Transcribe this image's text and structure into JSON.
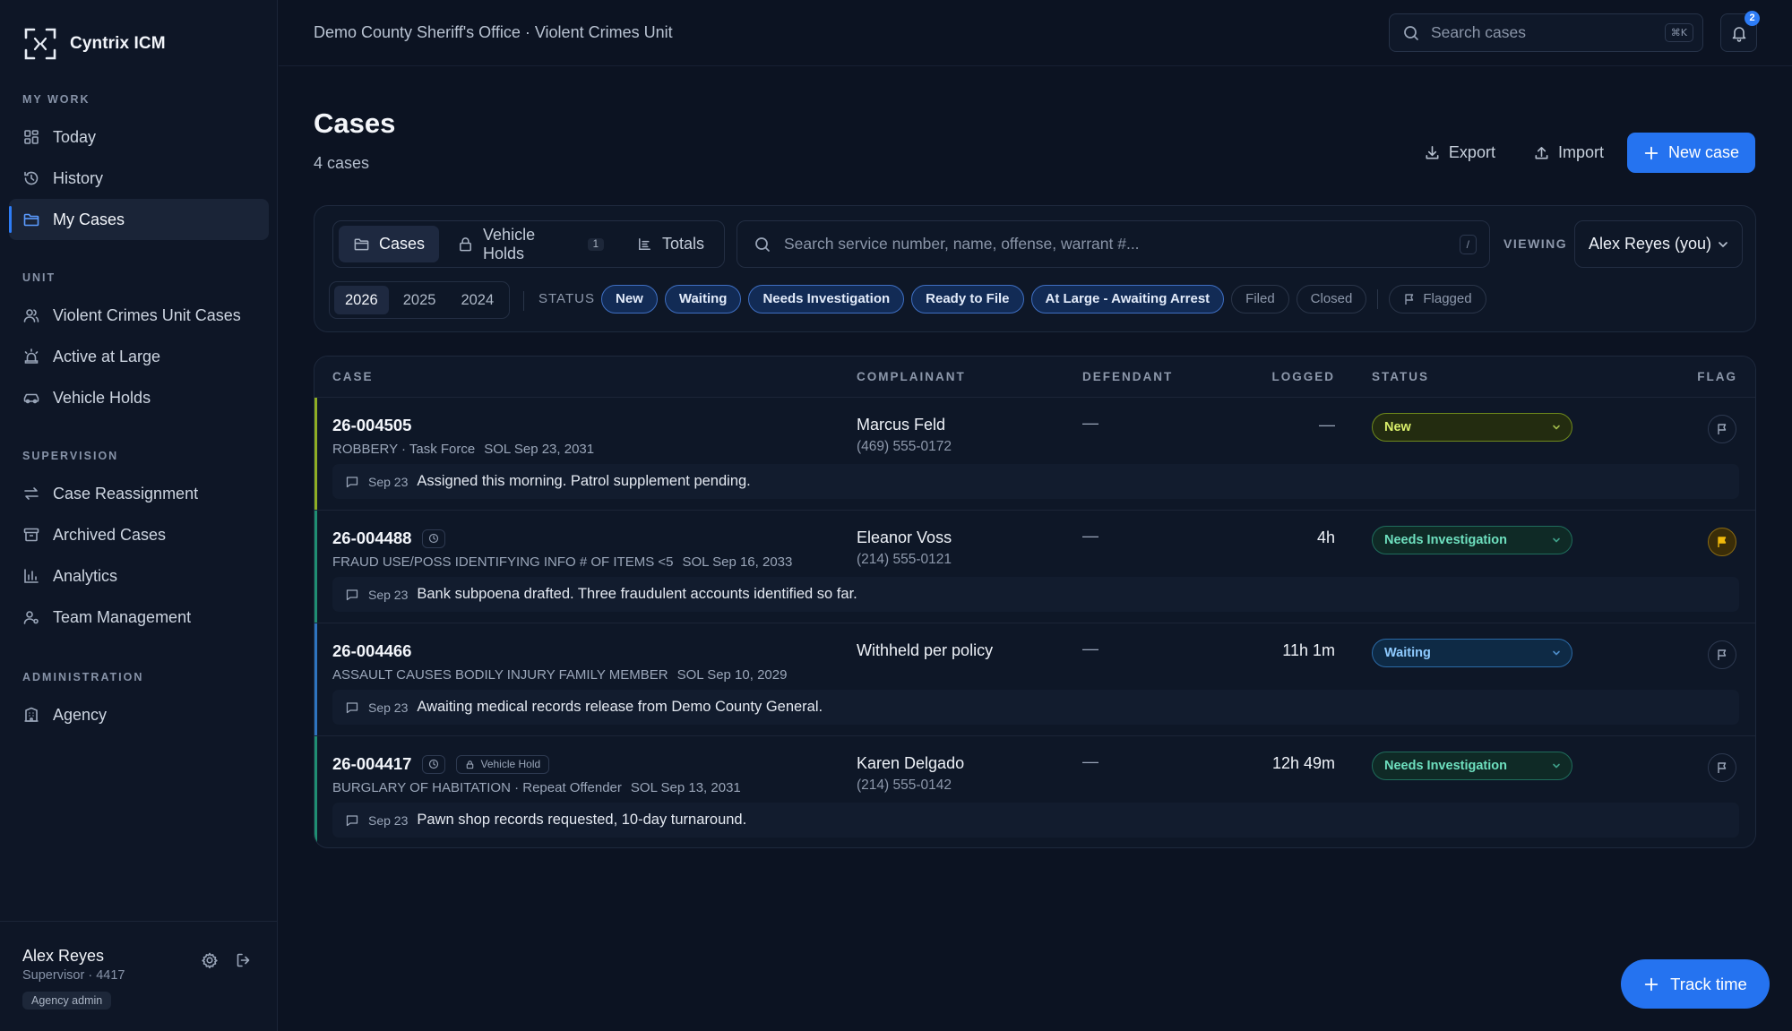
{
  "app": {
    "name": "Cyntrix ICM",
    "agency": "Demo County Sheriff's Office · Violent Crimes Unit"
  },
  "sidebar": {
    "sections": [
      {
        "label": "MY WORK",
        "items": [
          {
            "label": "Today",
            "icon": "grid-icon"
          },
          {
            "label": "History",
            "icon": "history-icon"
          },
          {
            "label": "My Cases",
            "icon": "folder-icon",
            "active": true
          }
        ]
      },
      {
        "label": "UNIT",
        "items": [
          {
            "label": "Violent Crimes Unit Cases",
            "icon": "users-icon"
          },
          {
            "label": "Active at Large",
            "icon": "siren-icon"
          },
          {
            "label": "Vehicle Holds",
            "icon": "car-icon"
          }
        ]
      },
      {
        "label": "SUPERVISION",
        "items": [
          {
            "label": "Case Reassignment",
            "icon": "swap-icon"
          },
          {
            "label": "Archived Cases",
            "icon": "archive-icon"
          },
          {
            "label": "Analytics",
            "icon": "bar-chart-icon"
          },
          {
            "label": "Team Management",
            "icon": "team-icon"
          }
        ]
      },
      {
        "label": "ADMINISTRATION",
        "items": [
          {
            "label": "Agency",
            "icon": "building-icon"
          }
        ]
      }
    ],
    "user": {
      "name": "Alex Reyes",
      "role": "Supervisor · 4417",
      "badge": "Agency admin"
    }
  },
  "topbar": {
    "search_placeholder": "Search cases",
    "shortcut": "⌘K",
    "notifications": "2"
  },
  "header": {
    "title": "Cases",
    "subtitle": "4 cases",
    "export_label": "Export",
    "import_label": "Import",
    "new_case_label": "New case"
  },
  "filters": {
    "tabs": [
      {
        "label": "Cases",
        "icon": "folder-icon",
        "active": true
      },
      {
        "label": "Vehicle Holds",
        "icon": "lock-icon",
        "count": "1"
      },
      {
        "label": "Totals",
        "icon": "list-icon"
      }
    ],
    "search_placeholder": "Search service number, name, offense, warrant #...",
    "search_shortcut": "/",
    "viewing_label": "VIEWING",
    "viewing_value": "Alex Reyes (you)",
    "years": [
      "2026",
      "2025",
      "2024"
    ],
    "active_year": "2026",
    "status_label": "STATUS",
    "statuses": [
      {
        "label": "New",
        "on": true
      },
      {
        "label": "Waiting",
        "on": true
      },
      {
        "label": "Needs Investigation",
        "on": true
      },
      {
        "label": "Ready to File",
        "on": true
      },
      {
        "label": "At Large - Awaiting Arrest",
        "on": true
      },
      {
        "label": "Filed",
        "on": false
      },
      {
        "label": "Closed",
        "on": false
      }
    ],
    "flagged_label": "Flagged"
  },
  "table": {
    "columns": {
      "case": "CASE",
      "complainant": "COMPLAINANT",
      "defendant": "DEFENDANT",
      "logged": "LOGGED",
      "status": "STATUS",
      "flag": "FLAG"
    },
    "rows": [
      {
        "id": "26-004505",
        "offense": "ROBBERY · Task Force",
        "sol": "SOL Sep 23, 2031",
        "complainant": "Marcus Feld",
        "phone": "(469) 555-0172",
        "defendant": "—",
        "logged": "—",
        "status": "New",
        "flagged": false,
        "accent": "#8fae24",
        "note_date": "Sep 23",
        "note": "Assigned this morning. Patrol supplement pending."
      },
      {
        "id": "26-004488",
        "offense": "FRAUD USE/POSS IDENTIFYING INFO # OF ITEMS <5",
        "sol": "SOL Sep 16, 2033",
        "complainant": "Eleanor Voss",
        "phone": "(214) 555-0121",
        "defendant": "—",
        "logged": "4h",
        "status": "Needs Investigation",
        "flagged": true,
        "accent": "#1f8f73",
        "clock": true,
        "note_date": "Sep 23",
        "note": "Bank subpoena drafted. Three fraudulent accounts identified so far."
      },
      {
        "id": "26-004466",
        "offense": "ASSAULT CAUSES BODILY INJURY FAMILY MEMBER",
        "sol": "SOL Sep 10, 2029",
        "complainant": "Withheld per policy",
        "phone": "",
        "defendant": "—",
        "logged": "11h 1m",
        "status": "Waiting",
        "flagged": false,
        "accent": "#2e74c0",
        "note_date": "Sep 23",
        "note": "Awaiting medical records release from Demo County General."
      },
      {
        "id": "26-004417",
        "offense": "BURGLARY OF HABITATION · Repeat Offender",
        "sol": "SOL Sep 13, 2031",
        "complainant": "Karen Delgado",
        "phone": "(214) 555-0142",
        "defendant": "—",
        "logged": "12h 49m",
        "status": "Needs Investigation",
        "flagged": false,
        "accent": "#1f8f73",
        "clock": true,
        "hold": "Vehicle Hold",
        "note_date": "Sep 23",
        "note": "Pawn shop records requested, 10-day turnaround."
      }
    ]
  },
  "track_time_label": "Track time",
  "colors": {
    "accent": "#2573f0",
    "background": "#0c1322",
    "flag": "#f0b90b"
  }
}
